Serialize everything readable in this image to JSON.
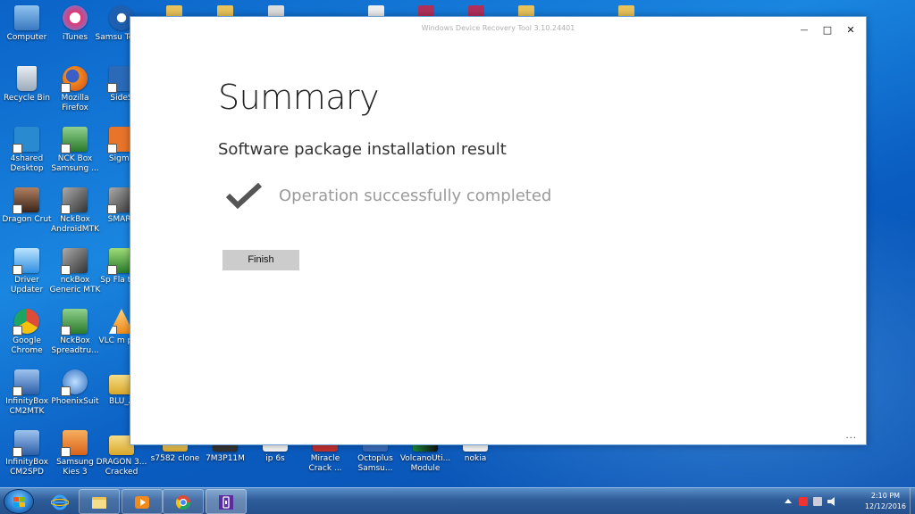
{
  "window": {
    "title": "Windows Device Recovery Tool 3.10.24401",
    "controls": {
      "minimize": "—",
      "maximize": "□",
      "close": "✕"
    },
    "heading": "Summary",
    "subheading": "Software package installation result",
    "status_text": "Operation successfully completed",
    "finish_label": "Finish",
    "more_label": "..."
  },
  "desktop_icons": [
    {
      "id": "computer",
      "label": "Computer",
      "icon": "computer-icon",
      "color": "#4a90d9"
    },
    {
      "id": "itunes",
      "label": "iTunes",
      "icon": "itunes-icon",
      "color": "#e8e8f0"
    },
    {
      "id": "samsung-tool",
      "label": "Samsu Tool P",
      "icon": "samsung-tool-icon",
      "color": "#2d6fb8"
    },
    {
      "id": "recycle-bin",
      "label": "Recycle Bin",
      "icon": "recycle-bin-icon",
      "color": "#c8d4e0"
    },
    {
      "id": "firefox",
      "label": "Mozilla Firefox",
      "icon": "firefox-icon",
      "color": "#e66a1f"
    },
    {
      "id": "sideshow",
      "label": "SideS",
      "icon": "sideshow-icon",
      "color": "#2a6ab8"
    },
    {
      "id": "4shared",
      "label": "4shared Desktop",
      "icon": "4shared-icon",
      "color": "#2a8ad0"
    },
    {
      "id": "nck-samsung",
      "label": "NCK Box Samsung ...",
      "icon": "nck-box-icon",
      "color": "#3a9a3a"
    },
    {
      "id": "sigma",
      "label": "Sigma",
      "icon": "sigma-icon",
      "color": "#e8742a"
    },
    {
      "id": "dragon-crut",
      "label": "Dragon Crut",
      "icon": "dragon-icon",
      "color": "#5a3a2a"
    },
    {
      "id": "nckbox-androidmtk",
      "label": "NckBox AndroidMTK",
      "icon": "nck-usb-icon",
      "color": "#555555"
    },
    {
      "id": "smart",
      "label": "SMART",
      "icon": "smart-icon",
      "color": "#777777"
    },
    {
      "id": "driver-updater",
      "label": "Driver Updater",
      "icon": "driver-updater-icon",
      "color": "#4aa0e0"
    },
    {
      "id": "nckbox-generic",
      "label": "nckBox Generic MTK",
      "icon": "nck-usb-icon",
      "color": "#555555"
    },
    {
      "id": "sp-flash",
      "label": "Sp Fla tool",
      "icon": "sp-flash-icon",
      "color": "#3a8a3a"
    },
    {
      "id": "chrome",
      "label": "Google Chrome",
      "icon": "chrome-icon",
      "color": "#dd4b39"
    },
    {
      "id": "nckbox-spreadtrum",
      "label": "NckBox Spreadtru...",
      "icon": "nck-box-icon",
      "color": "#3a9a3a"
    },
    {
      "id": "vlc",
      "label": "VLC m play",
      "icon": "vlc-icon",
      "color": "#f08a1c"
    },
    {
      "id": "infinitybox-mtk",
      "label": "InfinityBox CM2MTK",
      "icon": "infinitybox-icon",
      "color": "#4a7ab8"
    },
    {
      "id": "phoenixsuit",
      "label": "PhoenixSuit",
      "icon": "phoenixsuit-icon",
      "color": "#4a8ad0"
    },
    {
      "id": "blu",
      "label": "BLU_A",
      "icon": "folder-icon",
      "color": "#e8c25a"
    },
    {
      "id": "infinitybox-spd",
      "label": "InfinityBox CM2SPD",
      "icon": "infinitybox-icon",
      "color": "#4a7ab8"
    },
    {
      "id": "samsung-kies",
      "label": "Samsung Kies 3",
      "icon": "kies-icon",
      "color": "#e8842a"
    },
    {
      "id": "dragon-cracked",
      "label": "DRAGON 3... Cracked",
      "icon": "folder-icon",
      "color": "#e8c25a"
    }
  ],
  "bottom_icons": [
    {
      "id": "s7582",
      "label": "s7582 clone",
      "icon": "folder-icon"
    },
    {
      "id": "7m3p",
      "label": "7M3P11M",
      "icon": "file-icon"
    },
    {
      "id": "ip6s",
      "label": "ip 6s",
      "icon": "file-icon"
    },
    {
      "id": "miracle",
      "label": "Miracle Crack ...",
      "icon": "miracle-icon"
    },
    {
      "id": "octoplus",
      "label": "Octoplus Samsu...",
      "icon": "octoplus-icon"
    },
    {
      "id": "volcano",
      "label": "VolcanoUti... Module",
      "icon": "volcano-icon"
    },
    {
      "id": "nokia",
      "label": "nokia",
      "icon": "file-icon"
    }
  ],
  "taskbar": {
    "apps": [
      {
        "id": "ie",
        "icon": "internet-explorer-icon"
      },
      {
        "id": "explorer",
        "icon": "file-explorer-icon"
      },
      {
        "id": "media",
        "icon": "media-player-icon"
      },
      {
        "id": "chrome",
        "icon": "chrome-icon"
      },
      {
        "id": "recovery",
        "icon": "device-recovery-icon"
      }
    ],
    "clock_time": "2:10 PM",
    "clock_date": "12/12/2016"
  }
}
